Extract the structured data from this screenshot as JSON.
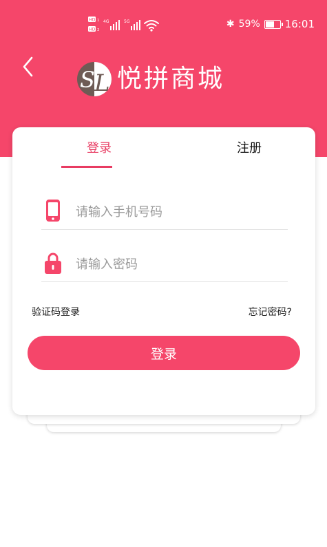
{
  "status_bar": {
    "hd_badge": "HD",
    "network": "4G",
    "network_2": "5G",
    "battery_percent": 59,
    "battery_text": "59%",
    "time": "16:01"
  },
  "header": {
    "title": "悦拼商城",
    "logo_text": "SL"
  },
  "tabs": [
    {
      "label": "登录",
      "active": true
    },
    {
      "label": "注册",
      "active": false
    }
  ],
  "form": {
    "phone": {
      "placeholder": "请输入手机号码",
      "value": ""
    },
    "password": {
      "placeholder": "请输入密码",
      "value": ""
    },
    "sms_login": "验证码登录",
    "forgot_password": "忘记密码?",
    "submit_label": "登录"
  },
  "colors": {
    "brand": "#f5466a",
    "accent": "#e83b62"
  },
  "icons": {
    "back": "chevron-left-icon",
    "phone": "phone-icon",
    "password": "lock-icon"
  }
}
